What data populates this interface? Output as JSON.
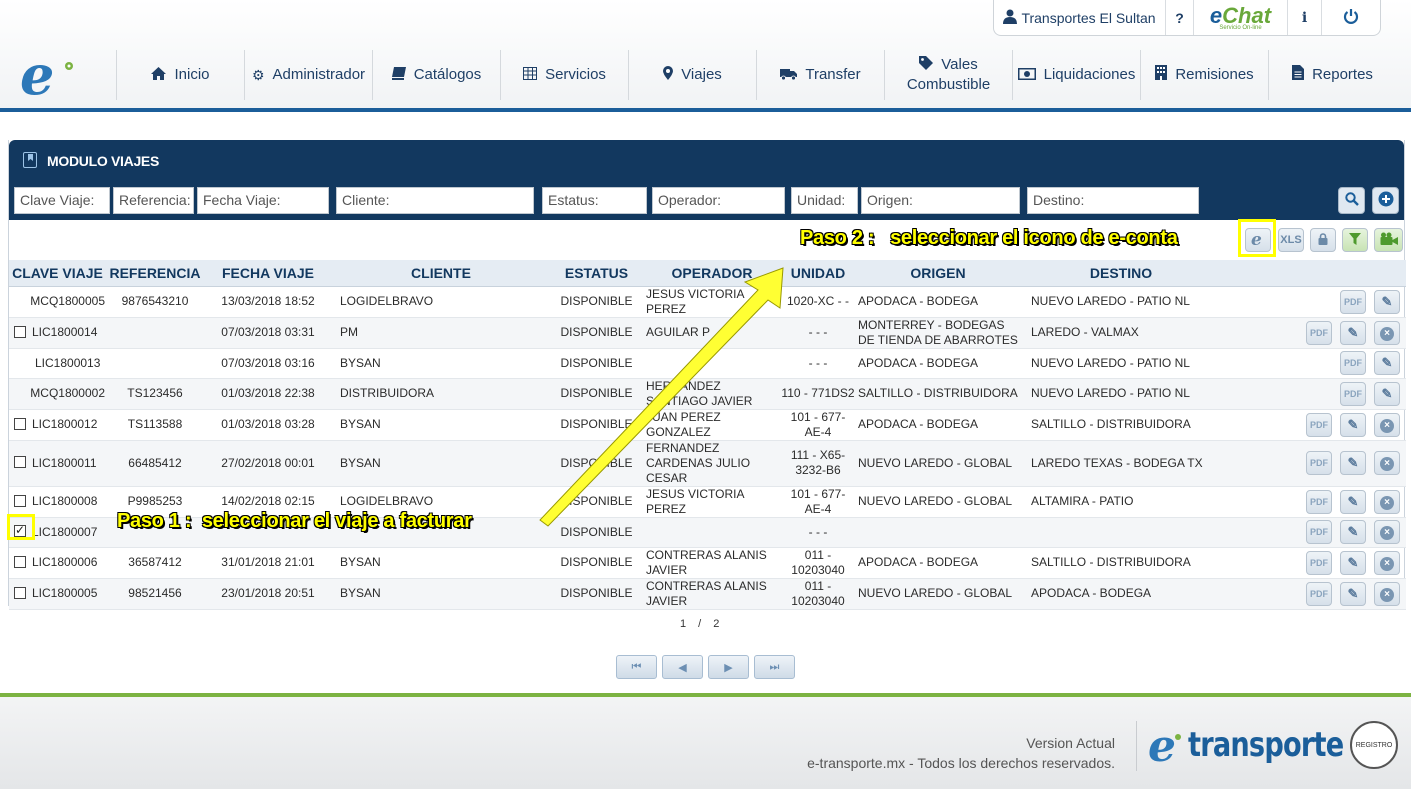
{
  "topbar": {
    "user": "Transportes El Sultan",
    "help": "?",
    "chat_brand_e": "e",
    "chat_brand_rest": "Chat",
    "chat_sub": "Servicio On-line",
    "info": "i"
  },
  "nav": [
    {
      "label": "Inicio",
      "icon": "home-icon"
    },
    {
      "label": "Administrador",
      "icon": "gears-icon"
    },
    {
      "label": "Catálogos",
      "icon": "book-icon"
    },
    {
      "label": "Servicios",
      "icon": "table-icon"
    },
    {
      "label": "Viajes",
      "icon": "map-marker-icon"
    },
    {
      "label": "Transfer",
      "icon": "truck-icon"
    },
    {
      "label": "Vales Combustible",
      "label_line1": "Vales",
      "label_line2": "Combustible",
      "icon": "tag-icon"
    },
    {
      "label": "Liquidaciones",
      "icon": "money-icon"
    },
    {
      "label": "Remisiones",
      "icon": "building-icon"
    },
    {
      "label": "Reportes",
      "icon": "file-icon"
    }
  ],
  "module": {
    "title": "MODULO VIAJES"
  },
  "filters": {
    "clave": "Clave Viaje:",
    "referencia": "Referencia:",
    "fecha": "Fecha Viaje:",
    "cliente": "Cliente:",
    "estatus": "Estatus:",
    "operador": "Operador:",
    "unidad": "Unidad:",
    "origen": "Origen:",
    "destino": "Destino:"
  },
  "toolbar": {
    "xls": "XLS"
  },
  "columns": [
    "CLAVE VIAJE",
    "REFERENCIA",
    "FECHA VIAJE",
    "CLIENTE",
    "ESTATUS",
    "OPERADOR",
    "UNIDAD",
    "ORIGEN",
    "DESTINO"
  ],
  "rows": [
    {
      "clave": "MCQ1800005",
      "ref": "9876543210",
      "fecha": "13/03/2018 18:52",
      "cliente": "LOGIDELBRAVO",
      "estatus": "DISPONIBLE",
      "operador": "JESUS VICTORIA PEREZ",
      "unidad": "1020-XC - -",
      "origen": "APODACA - BODEGA",
      "destino": "NUEVO LAREDO - PATIO NL"
    },
    {
      "clave": "LIC1800014",
      "ref": "",
      "fecha": "07/03/2018 03:31",
      "cliente": "PM",
      "estatus": "DISPONIBLE",
      "operador": "AGUILAR P",
      "unidad": "- - -",
      "origen": "MONTERREY - BODEGAS DE TIENDA DE ABARROTES",
      "destino": "LAREDO - VALMAX"
    },
    {
      "clave": "LIC1800013",
      "ref": "",
      "fecha": "07/03/2018 03:16",
      "cliente": "BYSAN",
      "estatus": "DISPONIBLE",
      "operador": "",
      "unidad": "- - -",
      "origen": "APODACA - BODEGA",
      "destino": "NUEVO LAREDO - PATIO NL"
    },
    {
      "clave": "MCQ1800002",
      "ref": "TS123456",
      "fecha": "01/03/2018 22:38",
      "cliente": "DISTRIBUIDORA",
      "estatus": "DISPONIBLE",
      "operador": "HERNANDEZ SANTIAGO JAVIER",
      "unidad": "110 - 771DS2",
      "origen": "SALTILLO - DISTRIBUIDORA",
      "destino": "NUEVO LAREDO - PATIO NL"
    },
    {
      "clave": "LIC1800012",
      "ref": "TS113588",
      "fecha": "01/03/2018 03:28",
      "cliente": "BYSAN",
      "estatus": "DISPONIBLE",
      "operador": "JUAN PEREZ GONZALEZ",
      "unidad": "101 - 677-AE-4",
      "origen": "APODACA - BODEGA",
      "destino": "SALTILLO - DISTRIBUIDORA"
    },
    {
      "clave": "LIC1800011",
      "ref": "66485412",
      "fecha": "27/02/2018 00:01",
      "cliente": "BYSAN",
      "estatus": "DISPONIBLE",
      "operador": "FERNANDEZ CARDENAS JULIO CESAR",
      "unidad": "111 - X65-3232-B6",
      "origen": "NUEVO LAREDO - GLOBAL",
      "destino": "LAREDO TEXAS - BODEGA TX"
    },
    {
      "clave": "LIC1800008",
      "ref": "P9985253",
      "fecha": "14/02/2018 02:15",
      "cliente": "LOGIDELBRAVO",
      "estatus": "DISPONIBLE",
      "operador": "JESUS VICTORIA PEREZ",
      "unidad": "101 - 677-AE-4",
      "origen": "NUEVO LAREDO - GLOBAL",
      "destino": "ALTAMIRA - PATIO"
    },
    {
      "clave": "LIC1800007",
      "ref": "",
      "fecha": "",
      "cliente": "",
      "estatus": "DISPONIBLE",
      "operador": "",
      "unidad": "- - -",
      "origen": "",
      "destino": ""
    },
    {
      "clave": "LIC1800006",
      "ref": "36587412",
      "fecha": "31/01/2018 21:01",
      "cliente": "BYSAN",
      "estatus": "DISPONIBLE",
      "operador": "CONTRERAS ALANIS JAVIER",
      "unidad": "011 - 10203040",
      "origen": "APODACA - BODEGA",
      "destino": "SALTILLO - DISTRIBUIDORA"
    },
    {
      "clave": "LIC1800005",
      "ref": "98521456",
      "fecha": "23/01/2018 20:51",
      "cliente": "BYSAN",
      "estatus": "DISPONIBLE",
      "operador": "CONTRERAS ALANIS JAVIER",
      "unidad": "011 - 10203040",
      "origen": "NUEVO LAREDO - GLOBAL",
      "destino": "APODACA - BODEGA"
    }
  ],
  "actions": {
    "pdf": "PDF",
    "delete": "×",
    "edit": "✎"
  },
  "pagination": {
    "current": "1",
    "sep": "/",
    "total": "2"
  },
  "footer": {
    "version": "Version Actual",
    "rights": "e-transporte.mx - Todos los derechos reservados.",
    "brand": "transporte",
    "seal": "REGISTRO"
  },
  "annotations": {
    "paso1": "Paso 1 :  seleccionar el viaje a facturar",
    "paso2": "Paso 2 :   seleccionar el icono de e-conta"
  },
  "colors": {
    "primary": "#12385f",
    "accent": "#1b5e9a",
    "green": "#7cb342",
    "highlight": "#ffff00"
  }
}
